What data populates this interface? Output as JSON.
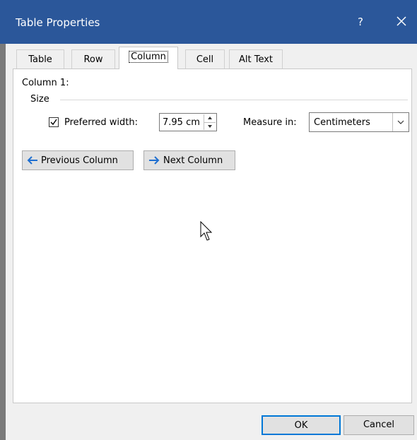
{
  "window": {
    "title": "Table Properties",
    "help": "?"
  },
  "tabs": [
    {
      "label": "Table"
    },
    {
      "label": "Row"
    },
    {
      "label": "Column"
    },
    {
      "label": "Cell"
    },
    {
      "label": "Alt Text"
    }
  ],
  "column": {
    "heading": "Column 1:",
    "size_label": "Size",
    "preferred_width_checked": true,
    "preferred_width_label": "Preferred width:",
    "width_value": "7.95 cm",
    "measure_label": "Measure in:",
    "measure_value": "Centimeters",
    "prev_label": "Previous Column",
    "next_label": "Next Column"
  },
  "footer": {
    "ok_label": "OK",
    "cancel_label": "Cancel"
  },
  "colors": {
    "titlebar": "#2b579a",
    "arrow": "#1f6fd0",
    "ok_border": "#0078d7"
  }
}
